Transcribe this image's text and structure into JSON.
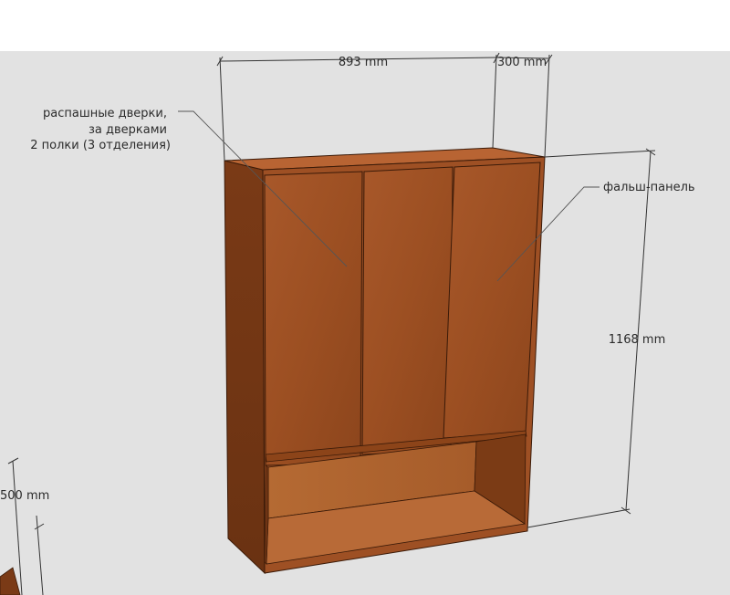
{
  "dimensions": {
    "width": "893 mm",
    "depth": "300 mm",
    "height": "1168 mm",
    "left_partial": "500 mm"
  },
  "notes": {
    "doors_line1": "распашные дверки,",
    "doors_line2": "за дверками",
    "doors_line3": "2 полки (3 отделения)",
    "panel": "фальш-панель"
  },
  "colors": {
    "background": "#e2e2e2",
    "sky": "#ffffff",
    "wood_front": "#9a4e22",
    "wood_dark": "#6e3414",
    "wood_light": "#b25f2c"
  }
}
